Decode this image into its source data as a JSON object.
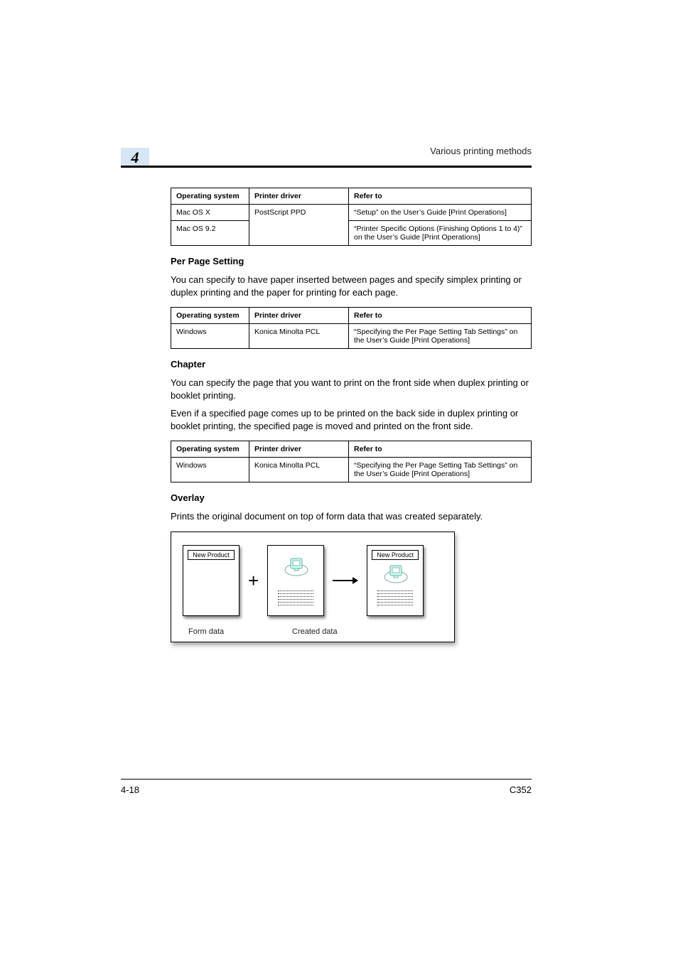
{
  "header": {
    "running_title": "Various printing methods",
    "chapter_number": "4"
  },
  "table1": {
    "cols": {
      "os": "Operating system",
      "driver": "Printer driver",
      "refer": "Refer to"
    },
    "rows": [
      {
        "os": "Mac OS X",
        "driver": "PostScript PPD",
        "refer": "“Setup” on the User’s Guide [Print Operations]"
      },
      {
        "os": "Mac OS 9.2",
        "driver": "",
        "refer": "“Printer Specific Options (Finishing Options 1 to 4)” on the User’s Guide [Print Operations]"
      }
    ]
  },
  "sec1": {
    "heading": "Per Page Setting",
    "para": "You can specify to have paper inserted between pages and specify simplex printing or duplex printing and the paper for printing for each page."
  },
  "table2": {
    "cols": {
      "os": "Operating system",
      "driver": "Printer driver",
      "refer": "Refer to"
    },
    "rows": [
      {
        "os": "Windows",
        "driver": "Konica Minolta PCL",
        "refer": "“Specifying the Per Page Setting Tab Settings” on the User’s Guide [Print Operations]"
      }
    ]
  },
  "sec2": {
    "heading": "Chapter",
    "para1": "You can specify the page that you want to print on the front side when duplex printing or booklet printing.",
    "para2": "Even if a specified page comes up to be printed on the back side in duplex printing or booklet printing, the specified page is moved and printed on the front side."
  },
  "table3": {
    "cols": {
      "os": "Operating system",
      "driver": "Printer driver",
      "refer": "Refer to"
    },
    "rows": [
      {
        "os": "Windows",
        "driver": "Konica Minolta PCL",
        "refer": "“Specifying the Per Page Setting Tab Settings” on the User’s Guide [Print Operations]"
      }
    ]
  },
  "sec3": {
    "heading": "Overlay",
    "para": "Prints the original document on top of form data that was created separately."
  },
  "diagram": {
    "form_label": "New Product",
    "result_label": "New Product",
    "caption_form": "Form data",
    "caption_created": "Created data"
  },
  "footer": {
    "left": "4-18",
    "right": "C352"
  }
}
